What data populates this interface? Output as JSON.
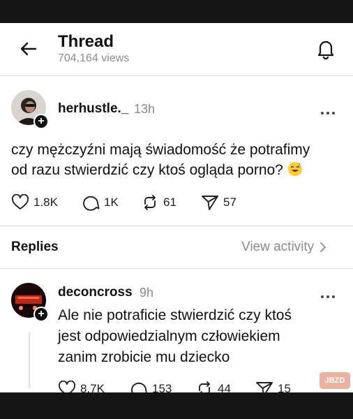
{
  "header": {
    "title": "Thread",
    "views": "704,164 views"
  },
  "post": {
    "username": "herhustle._",
    "time": "13h",
    "text_line1": "czy mężczyźni mają świadomość że potrafimy",
    "text_line2": "od razu stwierdzić czy ktoś ogląda porno?",
    "emoji": "grinning-sweat-emoji",
    "likes": "1.8K",
    "comments": "1K",
    "reposts": "61",
    "shares": "57"
  },
  "replies_section": {
    "label": "Replies",
    "view_activity": "View activity"
  },
  "reply": {
    "username": "deconcross",
    "time": "9h",
    "text_line1": "Ale nie potraficie stwierdzić czy ktoś",
    "text_line2": "jest odpowiedzialnym człowiekiem",
    "text_line3": "zanim zrobicie mu dziecko",
    "likes": "8.7K",
    "comments": "153",
    "reposts": "44",
    "shares": "15"
  },
  "watermark": "JBZD",
  "icons": {
    "back": "arrow-left-icon",
    "bell": "bell-icon",
    "more": "more-dots-icon",
    "like": "heart-icon",
    "comment": "comment-bubble-icon",
    "repost": "repost-icon",
    "share": "send-icon",
    "plus": "plus-icon",
    "chevron": "chevron-right-icon"
  },
  "colors": {
    "text": "#111111",
    "muted": "#8a8a8a",
    "divider": "#e3e3e3"
  }
}
